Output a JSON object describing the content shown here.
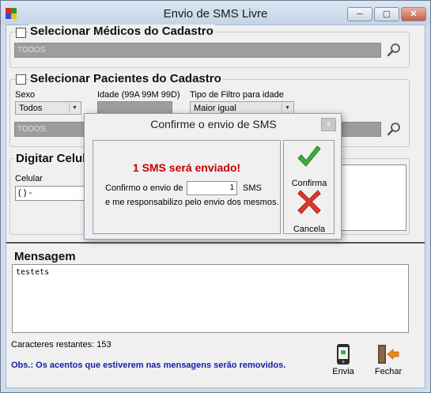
{
  "window": {
    "title": "Envio de SMS Livre",
    "minimize_glyph": "─",
    "maximize_glyph": "▢",
    "close_glyph": "✕"
  },
  "medicos": {
    "title": "Selecionar Médicos do Cadastro",
    "field_value": "TODOS",
    "search_icon": "magnifier-icon"
  },
  "pacientes": {
    "title": "Selecionar Pacientes do Cadastro",
    "sexo_label": "Sexo",
    "sexo_value": "Todos",
    "idade_label": "Idade (99A 99M 99D)",
    "idade_value": "",
    "filtro_label": "Tipo de Filtro para idade",
    "filtro_value": "Maior igual",
    "field_value": "TODOS",
    "search_icon": "magnifier-icon"
  },
  "celular": {
    "title": "Digitar Celula",
    "label": "Celular",
    "value": "(  )    -"
  },
  "dialog": {
    "title": "Confirme o envio de SMS",
    "close_glyph": "x",
    "headline": "1 SMS será enviado!",
    "confirm_prefix": "Confirmo o envio de",
    "count": "1",
    "confirm_suffix": "SMS",
    "responsibility": "e me responsabilizo pelo envio dos mesmos.",
    "confirm_label": "Confirma",
    "cancel_label": "Cancela"
  },
  "mensagem": {
    "title": "Mensagem",
    "text": "testets",
    "remaining_label": "Caracteres restantes:",
    "remaining_count": "153",
    "obs": "Obs.: Os acentos que estiverem nas mensagens serão removidos."
  },
  "toolbar": {
    "send_label": "Envia",
    "close_label": "Fechar"
  },
  "colors": {
    "headline_red": "#c40000",
    "obs_blue": "#1a1aa8",
    "disabled_field": "#9d9d9d"
  }
}
